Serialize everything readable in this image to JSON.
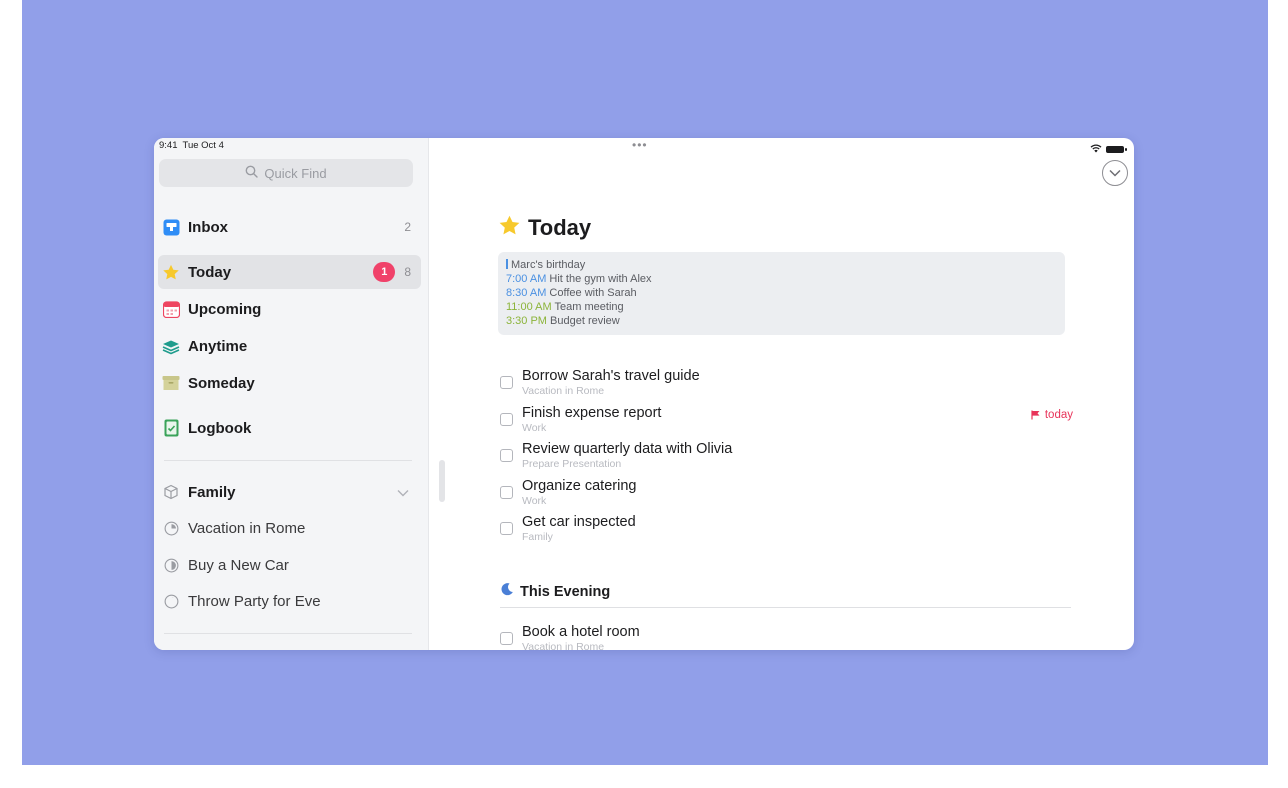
{
  "status_bar": {
    "time": "9:41",
    "date": "Tue Oct 4"
  },
  "sidebar": {
    "search_placeholder": "Quick Find",
    "nav": [
      {
        "label": "Inbox",
        "count": "2",
        "icon": "inbox-icon"
      },
      {
        "label": "Today",
        "badge": "1",
        "count": "8",
        "icon": "star-icon",
        "selected": true
      },
      {
        "label": "Upcoming",
        "icon": "calendar-icon"
      },
      {
        "label": "Anytime",
        "icon": "layers-icon"
      },
      {
        "label": "Someday",
        "icon": "archive-box-icon"
      },
      {
        "label": "Logbook",
        "icon": "logbook-icon"
      }
    ],
    "area": {
      "label": "Family",
      "icon": "cube-icon"
    },
    "projects": [
      {
        "label": "Vacation in Rome",
        "icon": "progress-pie-icon"
      },
      {
        "label": "Buy a New Car",
        "icon": "progress-pie-icon"
      },
      {
        "label": "Throw Party for Eve",
        "icon": "progress-pie-icon"
      }
    ]
  },
  "main": {
    "title": "Today",
    "calendar_events": [
      {
        "time": "",
        "text": "Marc's birthday",
        "color": "#4a90e2"
      },
      {
        "time": "7:00 AM",
        "text": "Hit the gym with Alex",
        "color": "#4a90e2"
      },
      {
        "time": "8:30 AM",
        "text": "Coffee with Sarah",
        "color": "#4a90e2"
      },
      {
        "time": "11:00 AM",
        "text": "Team meeting",
        "color": "#8cb43a"
      },
      {
        "time": "3:30 PM",
        "text": "Budget review",
        "color": "#8cb43a"
      }
    ],
    "todos": [
      {
        "name": "Borrow Sarah's travel guide",
        "project": "Vacation in Rome"
      },
      {
        "name": "Finish expense report",
        "project": "Work",
        "deadline": "today"
      },
      {
        "name": "Review quarterly data with Olivia",
        "project": "Prepare Presentation"
      },
      {
        "name": "Organize catering",
        "project": "Work"
      },
      {
        "name": "Get car inspected",
        "project": "Family"
      }
    ],
    "evening": {
      "title": "This Evening",
      "todos": [
        {
          "name": "Book a hotel room",
          "project": "Vacation in Rome"
        }
      ]
    }
  },
  "colors": {
    "background": "#919fe9",
    "badge": "#f0426a",
    "deadline": "#e8345a",
    "today_star": "#f7c92c"
  }
}
